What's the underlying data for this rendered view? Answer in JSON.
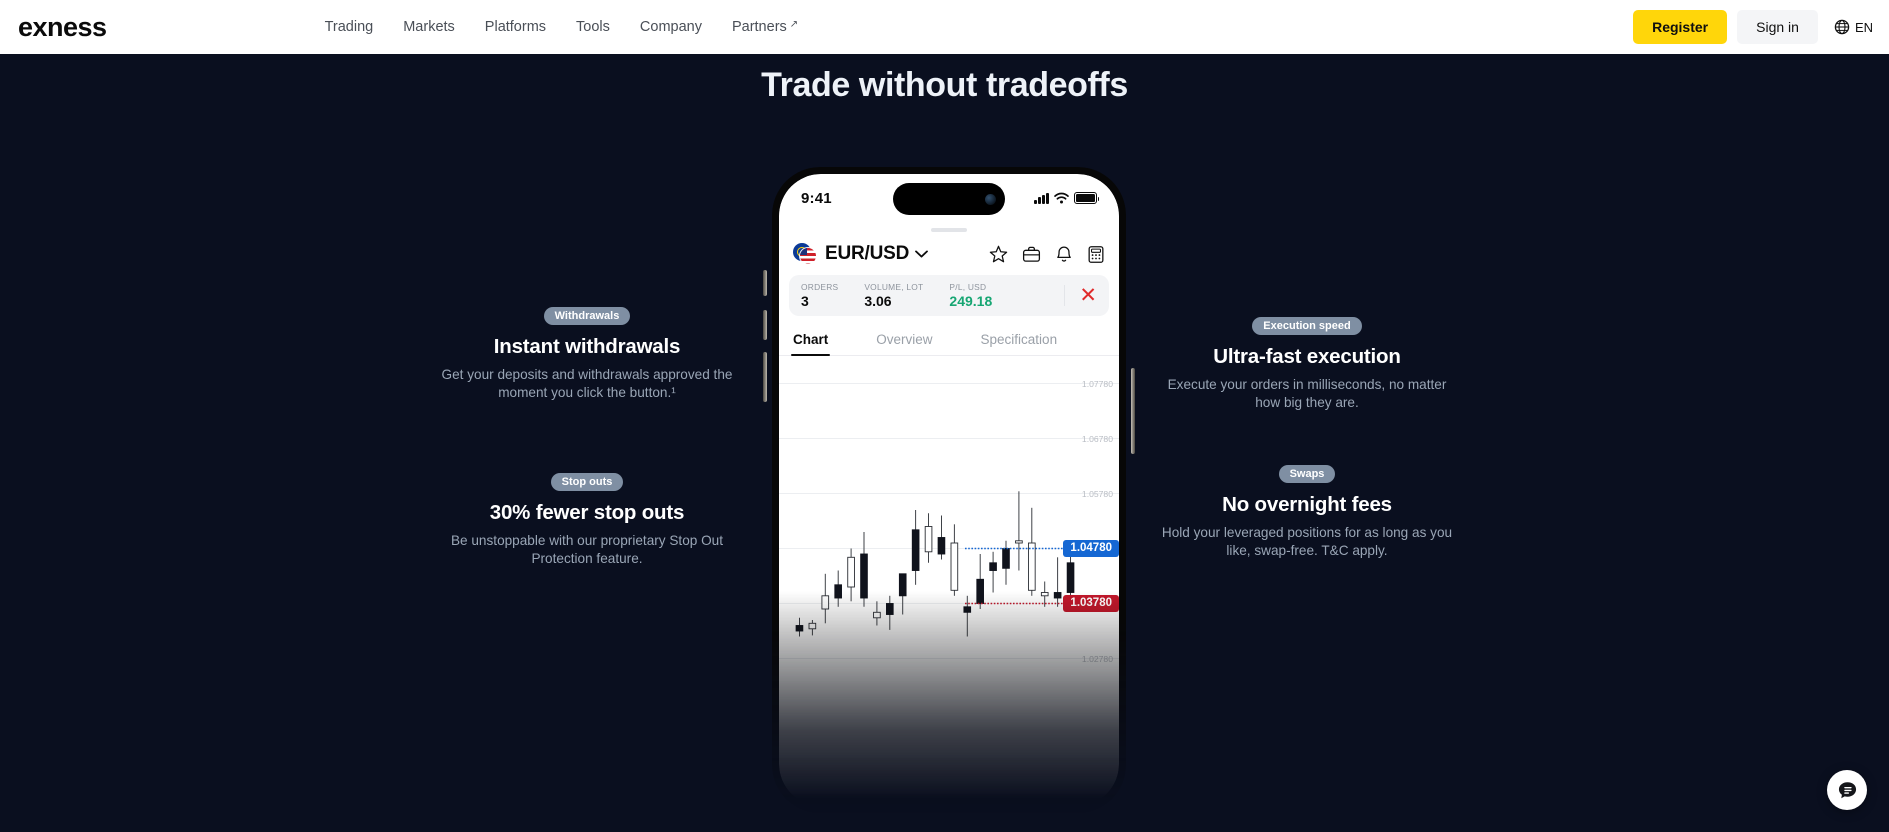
{
  "header": {
    "logo": "exness",
    "nav": [
      {
        "label": "Trading",
        "external": false
      },
      {
        "label": "Markets",
        "external": false
      },
      {
        "label": "Platforms",
        "external": false
      },
      {
        "label": "Tools",
        "external": false
      },
      {
        "label": "Company",
        "external": false
      },
      {
        "label": "Partners",
        "external": true
      }
    ],
    "register_label": "Register",
    "signin_label": "Sign in",
    "language": "EN",
    "register_color": "#ffd60a",
    "signin_bg": "#f4f5f7"
  },
  "hero": {
    "title": "Trade without tradeoffs",
    "background": "#0a0f1f"
  },
  "features": {
    "left": [
      {
        "badge": "Withdrawals",
        "title": "Instant withdrawals",
        "desc": "Get your deposits and withdrawals approved the moment you click the button.¹"
      },
      {
        "badge": "Stop outs",
        "title": "30% fewer stop outs",
        "desc": "Be unstoppable with our proprietary Stop Out Protection feature."
      }
    ],
    "right": [
      {
        "badge": "Execution speed",
        "title": "Ultra-fast execution",
        "desc": "Execute your orders in milliseconds, no matter how big they are."
      },
      {
        "badge": "Swaps",
        "title": "No overnight fees",
        "desc": "Hold your leveraged positions for as long as you like, swap-free. T&C apply."
      }
    ],
    "badge_color": "#7f8fa3"
  },
  "phone": {
    "status": {
      "time": "9:41",
      "signal": "signal-bars-icon",
      "wifi": "wifi-icon",
      "battery": "battery-icon"
    },
    "app": {
      "pair": "EUR/USD",
      "pair_chevron": "chevron-down-icon",
      "icons": [
        "star-icon",
        "briefcase-icon",
        "bell-icon",
        "calculator-icon"
      ],
      "stats": [
        {
          "label": "ORDERS",
          "value": "3",
          "color": "#0b0b0b"
        },
        {
          "label": "VOLUME, LOT",
          "value": "3.06",
          "color": "#0b0b0b"
        },
        {
          "label": "P/L, USD",
          "value": "249.18",
          "color": "#17a673"
        }
      ],
      "close_icon": "close-icon",
      "tabs": [
        {
          "label": "Chart",
          "active": true
        },
        {
          "label": "Overview",
          "active": false
        },
        {
          "label": "Specification",
          "active": false
        }
      ]
    }
  },
  "chart_data": {
    "type": "candlestick",
    "title": "EUR/USD",
    "xlabel": "",
    "ylabel": "",
    "grid": true,
    "ylim": [
      1.0228,
      1.0828
    ],
    "y_ticks": [
      "1.07780",
      "1.06780",
      "1.05780",
      "1.02780"
    ],
    "price_markers": [
      {
        "value": "1.04780",
        "color": "#1567d3",
        "type": "ask",
        "style": "solid-line"
      },
      {
        "value": "1.03780",
        "color": "#c2182b",
        "type": "bid",
        "style": "dotted-line"
      }
    ],
    "candles": [
      {
        "o": 1.0338,
        "h": 1.0352,
        "l": 1.0318,
        "c": 1.0328,
        "dir": "down"
      },
      {
        "o": 1.0332,
        "h": 1.0348,
        "l": 1.032,
        "c": 1.0342,
        "dir": "up"
      },
      {
        "o": 1.0368,
        "h": 1.0432,
        "l": 1.0342,
        "c": 1.0392,
        "dir": "up"
      },
      {
        "o": 1.0412,
        "h": 1.0438,
        "l": 1.0372,
        "c": 1.0388,
        "dir": "down"
      },
      {
        "o": 1.0408,
        "h": 1.0478,
        "l": 1.0382,
        "c": 1.0462,
        "dir": "up"
      },
      {
        "o": 1.0468,
        "h": 1.0508,
        "l": 1.0372,
        "c": 1.0388,
        "dir": "down"
      },
      {
        "o": 1.0362,
        "h": 1.0382,
        "l": 1.0338,
        "c": 1.0352,
        "dir": "up"
      },
      {
        "o": 1.0358,
        "h": 1.0392,
        "l": 1.033,
        "c": 1.0378,
        "dir": "down"
      },
      {
        "o": 1.0392,
        "h": 1.0432,
        "l": 1.0358,
        "c": 1.0432,
        "dir": "down"
      },
      {
        "o": 1.0438,
        "h": 1.0548,
        "l": 1.0412,
        "c": 1.0512,
        "dir": "down"
      },
      {
        "o": 1.0518,
        "h": 1.0542,
        "l": 1.0452,
        "c": 1.0472,
        "dir": "up"
      },
      {
        "o": 1.0498,
        "h": 1.0538,
        "l": 1.0458,
        "c": 1.0468,
        "dir": "down"
      },
      {
        "o": 1.0488,
        "h": 1.0522,
        "l": 1.0392,
        "c": 1.0402,
        "dir": "up"
      },
      {
        "o": 1.0372,
        "h": 1.0392,
        "l": 1.0318,
        "c": 1.0362,
        "dir": "down"
      },
      {
        "o": 1.0422,
        "h": 1.0468,
        "l": 1.0368,
        "c": 1.0378,
        "dir": "down"
      },
      {
        "o": 1.0452,
        "h": 1.0472,
        "l": 1.0398,
        "c": 1.0438,
        "dir": "down"
      },
      {
        "o": 1.0478,
        "h": 1.0492,
        "l": 1.0412,
        "c": 1.0442,
        "dir": "down"
      },
      {
        "o": 1.0492,
        "h": 1.0582,
        "l": 1.0438,
        "c": 1.0488,
        "dir": "up"
      },
      {
        "o": 1.0488,
        "h": 1.0552,
        "l": 1.0392,
        "c": 1.0402,
        "dir": "up"
      },
      {
        "o": 1.0398,
        "h": 1.0418,
        "l": 1.0372,
        "c": 1.0392,
        "dir": "up"
      },
      {
        "o": 1.0398,
        "h": 1.0462,
        "l": 1.0372,
        "c": 1.0388,
        "dir": "down"
      },
      {
        "o": 1.0452,
        "h": 1.0472,
        "l": 1.0392,
        "c": 1.0398,
        "dir": "down"
      }
    ]
  },
  "chat": {
    "icon": "chat-bubble-icon",
    "bg": "#ffffff"
  }
}
